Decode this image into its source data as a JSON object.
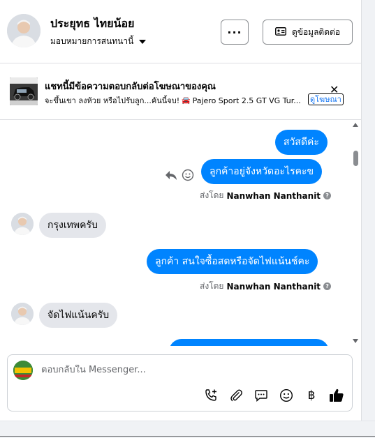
{
  "header": {
    "name": "ประยุทธ ไทยน้อย",
    "assignee": "มอบหมายการสนทนานี้",
    "more_label": "···",
    "contact_label": "ดูข้อมูลติดต่อ"
  },
  "ad": {
    "title": "แชทนี้มีข้อความตอบกลับต่อโฆษณาของคุณ",
    "text": "จะขึ้นเขา ลงห้วย หรือไปรับลูก...คันนี้จบ!",
    "car_label": "Pajero Sport 2.5 GT VG Tur...",
    "link_label": "ดูโฆษณา",
    "close_label": "✕"
  },
  "messages": {
    "m1": "สวัสดีค่ะ",
    "m2": "ลูกค้าอยู่จังหวัดอะไรคะข",
    "sent_by_prefix": "ส่งโดย",
    "sender": "Nanwhan Nanthanit",
    "m3": "กรุงเทพครับ",
    "m4": "ลูกค้า สนใจซื้อสดหรือจัดไฟแน้นช์คะ",
    "m5": "จัดไฟแน้นครับ"
  },
  "composer": {
    "placeholder": "ตอบกลับใน Messenger..."
  },
  "icons": {
    "reply": "reply-icon",
    "emoji": "smile-icon",
    "call": "phone-add-icon",
    "attach": "paperclip-icon",
    "saved_reply": "chat-bubble-icon",
    "emoji_tool": "smile-icon",
    "payment": "baht-icon",
    "like": "thumbs-up-icon"
  },
  "colors": {
    "outgoing_bubble": "#0084ff",
    "incoming_bubble": "#e4e6eb",
    "link": "#1877f2"
  }
}
